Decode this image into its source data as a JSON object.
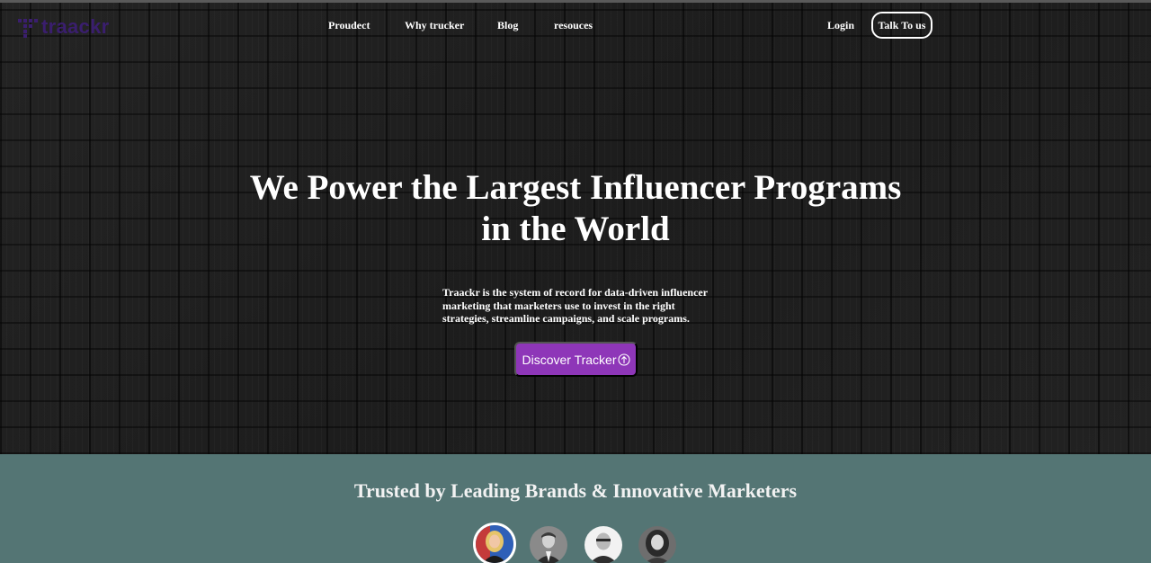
{
  "brand": {
    "name": "traackr",
    "color": "#3a1e6e"
  },
  "nav": {
    "items": [
      {
        "label": "Proudect"
      },
      {
        "label": "Why trucker"
      },
      {
        "label": "Blog"
      },
      {
        "label": "resouces"
      }
    ],
    "login_label": "Login",
    "talk_label": "Talk To us"
  },
  "hero": {
    "headline_line1": "We Power the Largest Influencer Programs",
    "headline_line2": "in the World",
    "subtext": "Traackr is the system of record for data-driven influencer marketing that marketers use to invest in the right strategies, streamline campaigns, and scale programs.",
    "cta_label": "Discover Tracker",
    "cta_icon": "arrow-up-circle-icon",
    "cta_color": "#8e36b8"
  },
  "trusted": {
    "title": "Trusted by Leading Brands & Innovative Marketers",
    "background": "#547574",
    "avatars": [
      {
        "name": "avatar-1",
        "active": true
      },
      {
        "name": "avatar-2",
        "active": false
      },
      {
        "name": "avatar-3",
        "active": false
      },
      {
        "name": "avatar-4",
        "active": false
      }
    ]
  }
}
